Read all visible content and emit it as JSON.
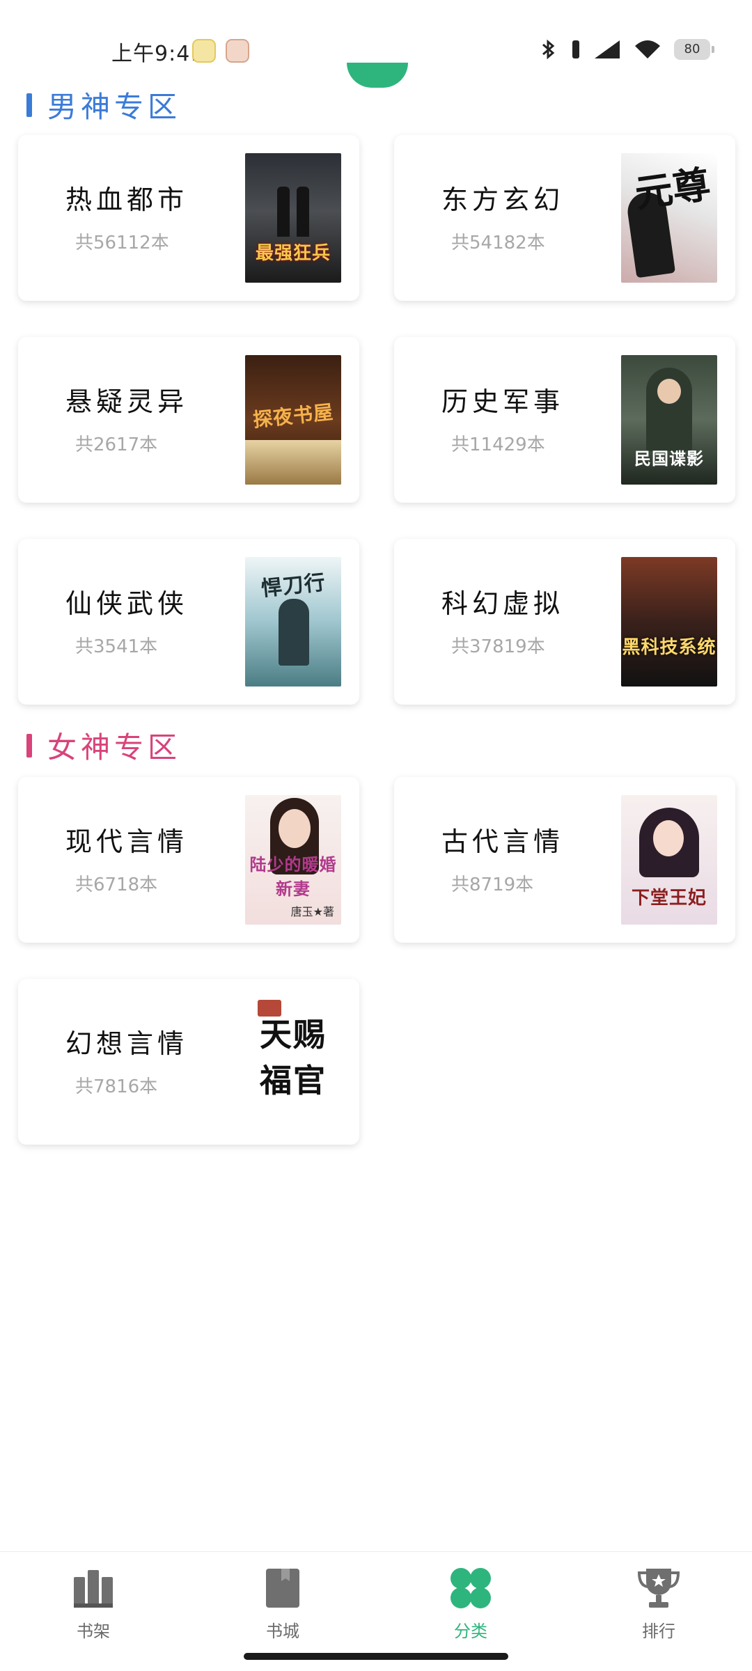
{
  "status_bar": {
    "time": "上午9:41",
    "battery": "80"
  },
  "sections": {
    "male": {
      "title": "男神专区",
      "accent": "#3b7bd8",
      "cards": [
        {
          "name": "热血都市",
          "count": "共56112本",
          "cover_title": "最强狂兵"
        },
        {
          "name": "东方玄幻",
          "count": "共54182本",
          "cover_title": "元尊"
        },
        {
          "name": "悬疑灵异",
          "count": "共2617本",
          "cover_title": "探夜书屋"
        },
        {
          "name": "历史军事",
          "count": "共11429本",
          "cover_title": "民国谍影"
        },
        {
          "name": "仙侠武侠",
          "count": "共3541本",
          "cover_title": "悍刀行"
        },
        {
          "name": "科幻虚拟",
          "count": "共37819本",
          "cover_title": "黑科技系统"
        }
      ]
    },
    "female": {
      "title": "女神专区",
      "accent": "#d8437a",
      "cards": [
        {
          "name": "现代言情",
          "count": "共6718本",
          "cover_title": "陆少的暖婚新妻",
          "cover_author": "唐玉★著"
        },
        {
          "name": "古代言情",
          "count": "共8719本",
          "cover_title": "下堂王妃"
        },
        {
          "name": "幻想言情",
          "count": "共7816本",
          "cover_title": "天赐福官"
        }
      ]
    }
  },
  "bottom_nav": {
    "items": [
      {
        "label": "书架",
        "icon": "bookshelf-icon"
      },
      {
        "label": "书城",
        "icon": "book-icon"
      },
      {
        "label": "分类",
        "icon": "clover-icon",
        "active": true
      },
      {
        "label": "排行",
        "icon": "trophy-icon"
      }
    ],
    "active_color": "#2eb57d"
  }
}
